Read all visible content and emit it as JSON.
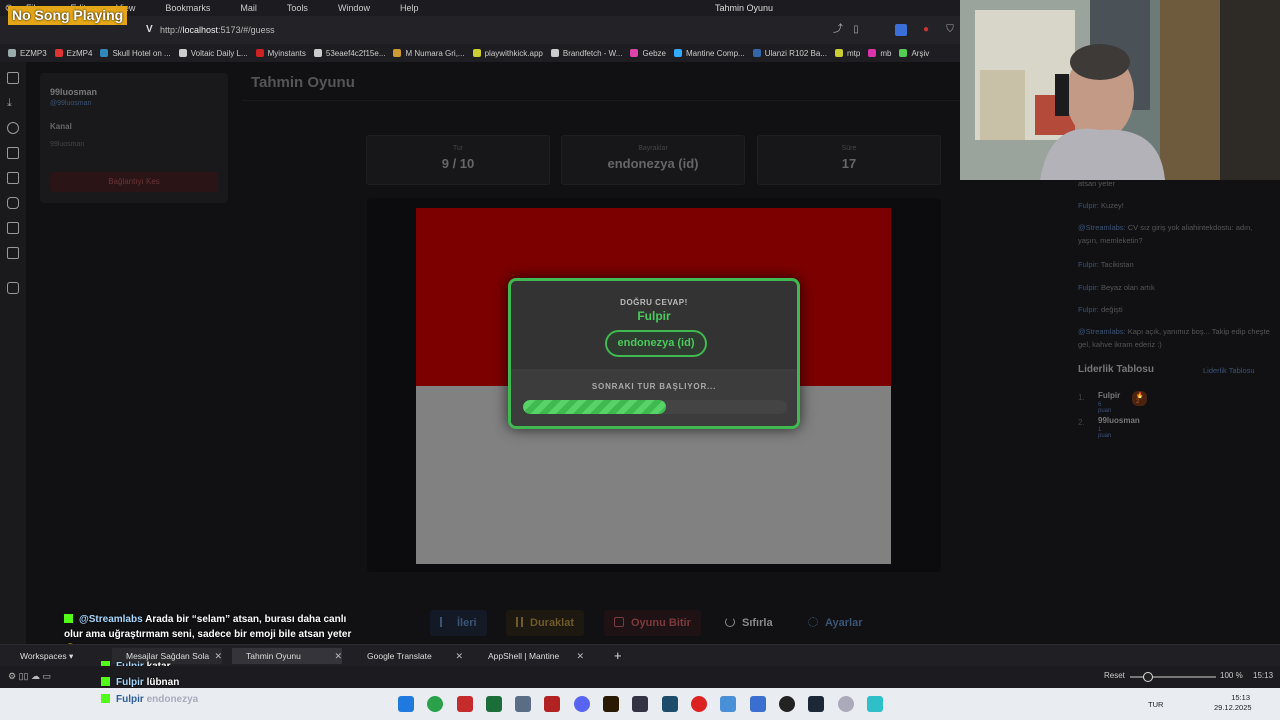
{
  "menubar": {
    "items": [
      "File",
      "Edit",
      "View",
      "Bookmarks",
      "Mail",
      "Tools",
      "Window",
      "Help"
    ],
    "window_title": "Tahmin Oyunu"
  },
  "overlay": {
    "now_playing": "No Song Playing"
  },
  "address": {
    "host": "localhost",
    "rest": ":5173/#/guess"
  },
  "bookmarks": [
    {
      "label": "EZMP3",
      "color": "#9aa"
    },
    {
      "label": "EzMP4",
      "color": "#d33"
    },
    {
      "label": "Skull Hotel on ...",
      "color": "#38b"
    },
    {
      "label": "Voltaic Daily L...",
      "color": "#ccc"
    },
    {
      "label": "Myinstants",
      "color": "#c22"
    },
    {
      "label": "53eaef4c2f15e...",
      "color": "#ccc"
    },
    {
      "label": "M Numara Gri,...",
      "color": "#c93"
    },
    {
      "label": "playwithkick.app",
      "color": "#cc3"
    },
    {
      "label": "Brandfetch - W...",
      "color": "#ccc"
    },
    {
      "label": "Gebze",
      "color": "#d4a"
    },
    {
      "label": "Mantine Comp...",
      "color": "#3af"
    },
    {
      "label": "Ulanzi R102 Ba...",
      "color": "#36a"
    },
    {
      "label": "mtp",
      "color": "#cc3"
    },
    {
      "label": "mb",
      "color": "#d3a"
    },
    {
      "label": "Arşiv",
      "color": "#5c5"
    }
  ],
  "app": {
    "user": {
      "name": "99luosman",
      "handle": "@99luosman"
    },
    "channel_label": "Kanal",
    "channel_value": "99luosman",
    "disconnect_label": "Bağlantıyı Kes",
    "page_title": "Tahmin Oyunu",
    "stats": [
      {
        "label": "Tur",
        "value": "9 / 10"
      },
      {
        "label": "Bayraklar",
        "value": "endonezya (id)"
      },
      {
        "label": "Süre",
        "value": "17"
      }
    ],
    "flag_colors": {
      "top": "#7c0000",
      "bottom": "#818181"
    },
    "modal": {
      "title": "DOĞRU CEVAP!",
      "winner": "Fulpir",
      "answer": "endonezya (id)",
      "next_text": "SONRAKI TUR BAŞLIYOR...",
      "progress_fraction": 0.54
    },
    "buttons": [
      {
        "label": "İleri",
        "color": "#3b5375",
        "bg": "#131a25"
      },
      {
        "label": "Duraklat",
        "color": "#6e5a2a",
        "bg": "#1d1810"
      },
      {
        "label": "Oyunu Bitir",
        "color": "#7b3a3d",
        "bg": "#1f1214"
      },
      {
        "label": "Sıfırla",
        "color": "#8a8a8a",
        "bg": "transparent"
      },
      {
        "label": "Ayarlar",
        "color": "#3b5375",
        "bg": "transparent"
      }
    ]
  },
  "chat": {
    "messages": [
      {
        "user": "",
        "text": "atsan yeter"
      },
      {
        "user": "Fulpir:",
        "text": "Kuzey!"
      },
      {
        "user": "@Streamlabs:",
        "text": "CV sız giriş yok aliahintekdostu: adın, yaşın, memleketin?"
      },
      {
        "user": "Fulpir:",
        "text": "Tacikistan"
      },
      {
        "user": "Fulpir:",
        "text": "Beyaz olan artık"
      },
      {
        "user": "Fulpir:",
        "text": "değişti"
      },
      {
        "user": "@Streamlabs:",
        "text": "Kapı açık, yanımız boş... Takip edip cheşte gel, kahve ikram ederiz :)"
      }
    ],
    "leaderboard_title": "Liderlik Tablosu",
    "leaderboard_link": "Liderlik Tablosu",
    "leaderboard": [
      {
        "rank": "1.",
        "name": "Fulpir",
        "sub": "6 puan",
        "badge": "🔥 2"
      },
      {
        "rank": "2.",
        "name": "99luosman",
        "sub": "1 puan",
        "badge": ""
      }
    ]
  },
  "stream_chat": [
    {
      "user": "@Streamlabs",
      "text": "Arada bir “selam” atsan, burası daha canlı olur ama uğraştırmam seni, sadece bir emoji bile atsan yeter 😍"
    },
    {
      "user": "Fulpir",
      "text": "katar"
    },
    {
      "user": "Fulpir",
      "text": "lübnan"
    },
    {
      "user": "Fulpir",
      "text": "endonezya"
    }
  ],
  "vivaldi": {
    "workspaces": "Workspaces",
    "tabs": [
      "Mesajlar Sağdan Sola",
      "Tahmin Oyunu",
      "Google Translate",
      "AppShell | Mantine"
    ],
    "reset": "Reset",
    "zoom": "100 %",
    "clock": "15:13"
  },
  "taskbar": {
    "lang": "TUR",
    "time": "15:13",
    "date": "29.12.2025"
  }
}
